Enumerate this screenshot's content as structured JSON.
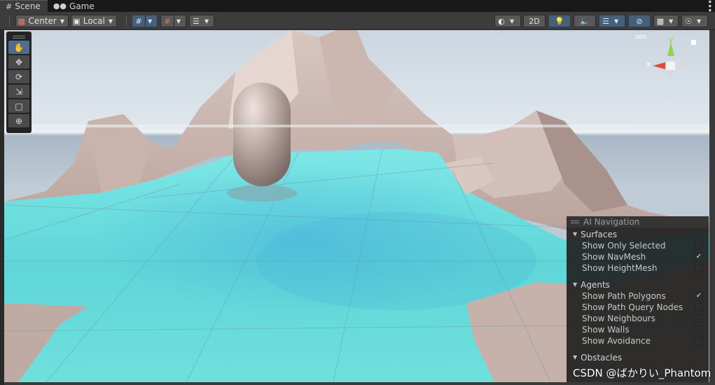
{
  "tabs": [
    {
      "label": "Scene",
      "icon": "hash-icon"
    },
    {
      "label": "Game",
      "icon": "gamepad-icon"
    }
  ],
  "toolbar": {
    "pivot_mode": "Center",
    "pivot_rotation": "Local",
    "view_2d": "2D"
  },
  "gizmo": {
    "y_label": "y",
    "x_label": "x",
    "projection": "Persp"
  },
  "ai_navigation": {
    "title": "AI Navigation",
    "sections": [
      {
        "label": "Surfaces",
        "items": [
          {
            "label": "Show Only Selected",
            "checked": false
          },
          {
            "label": "Show NavMesh",
            "checked": true
          },
          {
            "label": "Show HeightMesh",
            "checked": false
          }
        ]
      },
      {
        "label": "Agents",
        "items": [
          {
            "label": "Show Path Polygons",
            "checked": true
          },
          {
            "label": "Show Path Query Nodes",
            "checked": false
          },
          {
            "label": "Show Neighbours",
            "checked": false
          },
          {
            "label": "Show Walls",
            "checked": false
          },
          {
            "label": "Show Avoidance",
            "checked": false
          }
        ]
      },
      {
        "label": "Obstacles",
        "items": []
      }
    ]
  },
  "watermark": "CSDN @ばかりい_Phantom",
  "colors": {
    "navmesh": "#5ed8d8",
    "terrain": "#c9b3ad",
    "selected_tool": "#4e6c8c"
  }
}
